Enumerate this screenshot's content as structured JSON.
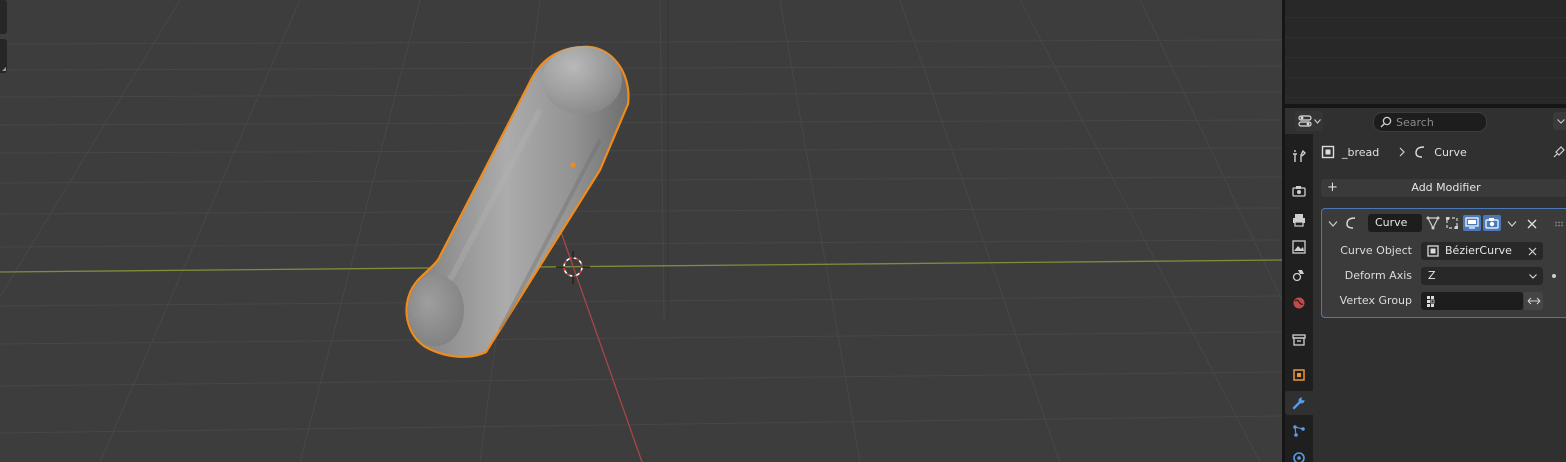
{
  "properties": {
    "search": {
      "placeholder": "Search"
    },
    "breadcrumb": {
      "object": "_bread",
      "modifier": "Curve"
    },
    "add_modifier_label": "Add Modifier",
    "modifier": {
      "name": "Curve",
      "curve_object_label": "Curve Object",
      "curve_object_value": "BézierCurve",
      "deform_axis_label": "Deform Axis",
      "deform_axis_value": "Z",
      "vertex_group_label": "Vertex Group",
      "vertex_group_value": ""
    },
    "tabs": [
      "tool-tab",
      "render-tab",
      "output-tab",
      "view-layer-tab",
      "scene-tab",
      "world-tab",
      "collection-tab",
      "object-tab",
      "modifier-tab",
      "particles-tab",
      "physics-tab"
    ],
    "active_tab": "modifier-tab"
  },
  "colors": {
    "viewport_bg": "#3d3d3d",
    "grid_line": "#474747",
    "x_axis": "#8a9a3e",
    "y_axis": "#b84949",
    "selection_outline": "#f08c1c",
    "accent_blue": "#4a78b8",
    "panel_bg": "#303030"
  }
}
